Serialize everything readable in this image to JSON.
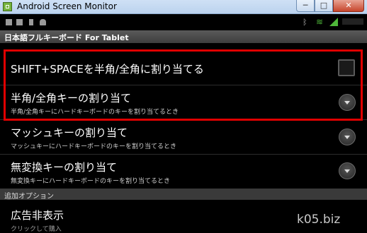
{
  "window": {
    "title": "Android Screen Monitor",
    "minimize_glyph": "─",
    "maximize_glyph": "□",
    "close_glyph": "✕"
  },
  "statusbar": {
    "icons": [
      "notification-icon",
      "notification-icon",
      "usb-icon",
      "android-debug-icon"
    ],
    "right_icons": [
      "bluetooth-icon",
      "wifi-icon",
      "signal-icon"
    ],
    "bluetooth_glyph": "ᛒ",
    "wifi_glyph": "≋"
  },
  "app": {
    "title": "日本語フルキーボード For Tablet"
  },
  "preferences": [
    {
      "title": "SHIFT+SPACEを半角/全角に割り当てる",
      "summary": "",
      "widget": "checkbox",
      "checked": false
    },
    {
      "title": "半角/全角キーの割り当て",
      "summary": "半角/全角キーにハードキーボードのキーを割り当てるとき",
      "widget": "dropdown"
    },
    {
      "title": "マッシュキーの割り当て",
      "summary": "マッシュキーにハードキーボードのキーを割り当てるとき",
      "widget": "dropdown"
    },
    {
      "title": "無変換キーの割り当て",
      "summary": "無変換キーにハードキーボードのキーを割り当てるとき",
      "widget": "dropdown"
    }
  ],
  "category": {
    "label": "追加オプション"
  },
  "ad_pref": {
    "title": "広告非表示",
    "summary": "クリックして購入"
  },
  "watermark": "k05.biz",
  "colors": {
    "highlight": "#e00000",
    "accent": "#4fb83a"
  }
}
